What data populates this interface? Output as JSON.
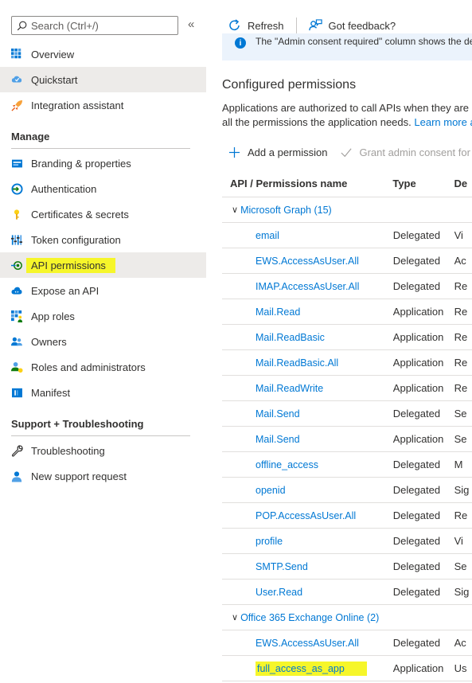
{
  "sidebar": {
    "search_placeholder": "Search (Ctrl+/)",
    "collapse_glyph": "«",
    "top_items": [
      {
        "label": "Overview",
        "icon": "overview-icon"
      },
      {
        "label": "Quickstart",
        "icon": "quickstart-icon"
      },
      {
        "label": "Integration assistant",
        "icon": "rocket-icon"
      }
    ],
    "manage_title": "Manage",
    "manage_items": [
      {
        "label": "Branding & properties",
        "icon": "branding-icon"
      },
      {
        "label": "Authentication",
        "icon": "authentication-icon"
      },
      {
        "label": "Certificates & secrets",
        "icon": "key-icon"
      },
      {
        "label": "Token configuration",
        "icon": "token-icon"
      },
      {
        "label": "API permissions",
        "icon": "api-permissions-icon"
      },
      {
        "label": "Expose an API",
        "icon": "cloud-icon"
      },
      {
        "label": "App roles",
        "icon": "app-roles-icon"
      },
      {
        "label": "Owners",
        "icon": "owners-icon"
      },
      {
        "label": "Roles and administrators",
        "icon": "roles-icon"
      },
      {
        "label": "Manifest",
        "icon": "manifest-icon"
      }
    ],
    "support_title": "Support + Troubleshooting",
    "support_items": [
      {
        "label": "Troubleshooting",
        "icon": "wrench-icon"
      },
      {
        "label": "New support request",
        "icon": "support-person-icon"
      }
    ]
  },
  "toolbar": {
    "refresh_label": "Refresh",
    "feedback_label": "Got feedback?"
  },
  "info_bar": {
    "text": "The \"Admin consent required\" column shows the de"
  },
  "main": {
    "title": "Configured permissions",
    "desc_line1": "Applications are authorized to call APIs when they are g",
    "desc_line2_prefix": "all the permissions the application needs. ",
    "desc_link": "Learn more a",
    "add_permission": "Add a permission",
    "grant_consent": "Grant admin consent for"
  },
  "table": {
    "headers": {
      "name": "API / Permissions name",
      "type": "Type",
      "desc": "De"
    },
    "groups": [
      {
        "name": "Microsoft Graph (15)",
        "rows": [
          {
            "name": "email",
            "type": "Delegated",
            "desc": "Vi"
          },
          {
            "name": "EWS.AccessAsUser.All",
            "type": "Delegated",
            "desc": "Ac"
          },
          {
            "name": "IMAP.AccessAsUser.All",
            "type": "Delegated",
            "desc": "Re"
          },
          {
            "name": "Mail.Read",
            "type": "Application",
            "desc": "Re"
          },
          {
            "name": "Mail.ReadBasic",
            "type": "Application",
            "desc": "Re"
          },
          {
            "name": "Mail.ReadBasic.All",
            "type": "Application",
            "desc": "Re"
          },
          {
            "name": "Mail.ReadWrite",
            "type": "Application",
            "desc": "Re"
          },
          {
            "name": "Mail.Send",
            "type": "Delegated",
            "desc": "Se"
          },
          {
            "name": "Mail.Send",
            "type": "Application",
            "desc": "Se"
          },
          {
            "name": "offline_access",
            "type": "Delegated",
            "desc": "M"
          },
          {
            "name": "openid",
            "type": "Delegated",
            "desc": "Sig"
          },
          {
            "name": "POP.AccessAsUser.All",
            "type": "Delegated",
            "desc": "Re"
          },
          {
            "name": "profile",
            "type": "Delegated",
            "desc": "Vi"
          },
          {
            "name": "SMTP.Send",
            "type": "Delegated",
            "desc": "Se"
          },
          {
            "name": "User.Read",
            "type": "Delegated",
            "desc": "Sig"
          }
        ]
      },
      {
        "name": "Office 365 Exchange Online (2)",
        "rows": [
          {
            "name": "EWS.AccessAsUser.All",
            "type": "Delegated",
            "desc": "Ac"
          },
          {
            "name": "full_access_as_app",
            "type": "Application",
            "desc": "Us"
          }
        ]
      }
    ]
  },
  "colors": {
    "accent": "#0078d4",
    "highlight": "#f6f62a",
    "selected_bg": "#edebe9",
    "info_bg": "#ebf3fc"
  }
}
